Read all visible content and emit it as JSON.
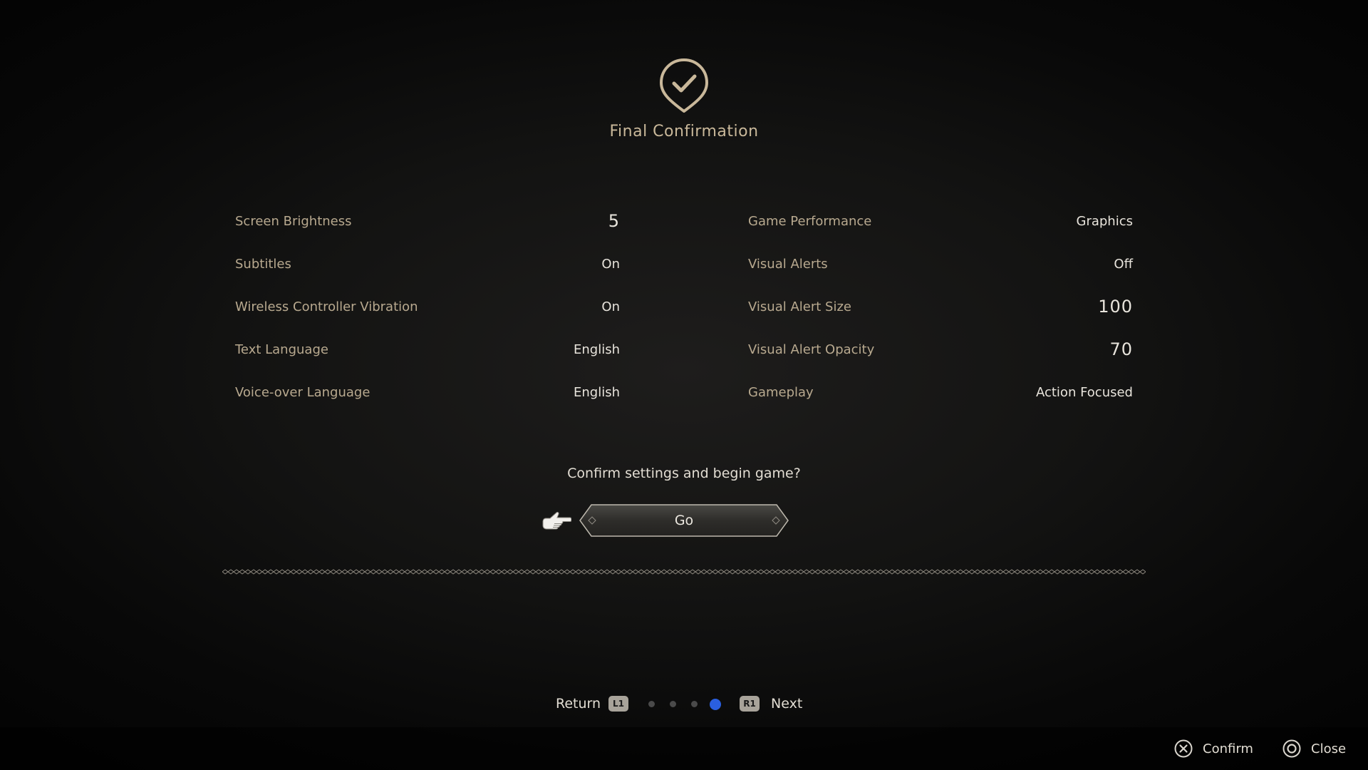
{
  "header": {
    "icon": "check-shield-icon",
    "title": "Final Confirmation"
  },
  "settings": {
    "left": [
      {
        "label": "Screen Brightness",
        "value": "5"
      },
      {
        "label": "Subtitles",
        "value": "On"
      },
      {
        "label": "Wireless Controller Vibration",
        "value": "On"
      },
      {
        "label": "Text Language",
        "value": "English"
      },
      {
        "label": "Voice-over Language",
        "value": "English"
      }
    ],
    "right": [
      {
        "label": "Game Performance",
        "value": "Graphics"
      },
      {
        "label": "Visual Alerts",
        "value": "Off"
      },
      {
        "label": "Visual Alert Size",
        "value": "100"
      },
      {
        "label": "Visual Alert Opacity",
        "value": "70"
      },
      {
        "label": "Gameplay",
        "value": "Action Focused"
      }
    ]
  },
  "prompt": "Confirm settings and begin game?",
  "go_button": {
    "label": "Go",
    "cursor_icon": "pointing-hand-icon"
  },
  "pager": {
    "return_label": "Return",
    "return_button": "L1",
    "next_button": "R1",
    "next_label": "Next",
    "page_count": 4,
    "current_page": 4,
    "active_color": "#2a5fe0"
  },
  "footer": {
    "confirm": {
      "icon": "cross-button-icon",
      "label": "Confirm"
    },
    "close": {
      "icon": "circle-button-icon",
      "label": "Close"
    }
  },
  "colors": {
    "label": "#b8a98f",
    "value": "#e8e4dc",
    "accent_gold": "#c9b89a"
  }
}
